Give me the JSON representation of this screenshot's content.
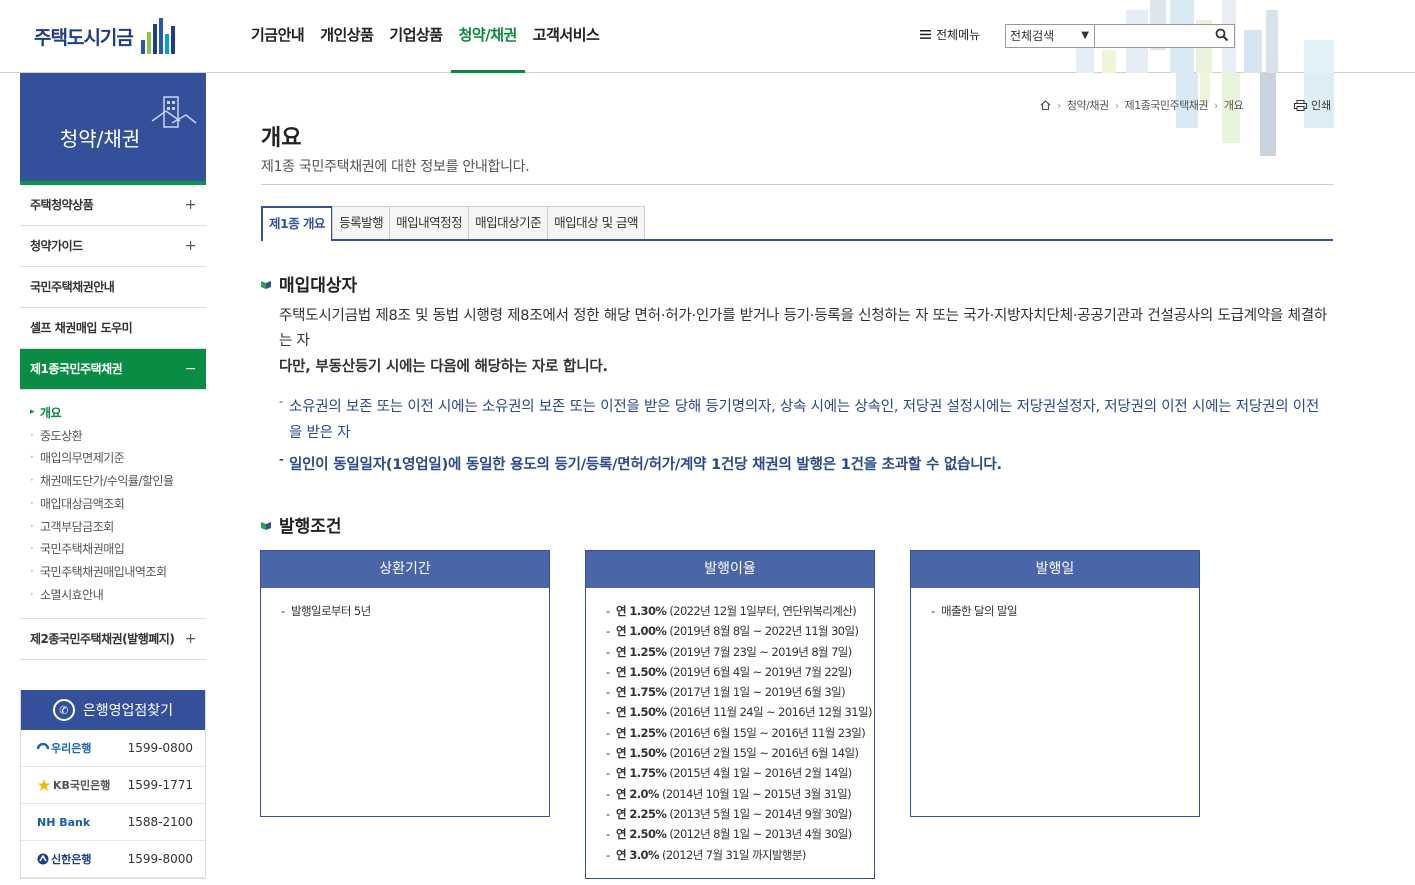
{
  "header": {
    "logo_text": "주택도시기금",
    "nav": [
      "기금안내",
      "개인상품",
      "기업상품",
      "청약/채권",
      "고객서비스"
    ],
    "nav_active": "청약/채권",
    "all_menu": "전체메뉴",
    "search_select": "전체검색",
    "search_placeholder": ""
  },
  "sidebar": {
    "title": "청약/채권",
    "items": [
      {
        "label": "주택청약상품",
        "toggle": "+"
      },
      {
        "label": "청약가이드",
        "toggle": "+"
      },
      {
        "label": "국민주택채권안내",
        "toggle": ""
      },
      {
        "label": "셀프 채권매입 도우미",
        "toggle": ""
      },
      {
        "label": "제1종국민주택채권",
        "toggle": "−"
      },
      {
        "label": "제2종국민주택채권(발행폐지)",
        "toggle": "+"
      }
    ],
    "sub_items": [
      "개요",
      "중도상환",
      "매입의무면제기준",
      "채권매도단가/수익률/할인율",
      "매입대상금액조회",
      "고객부담금조회",
      "국민주택채권매입",
      "국민주택채권매입내역조회",
      "소멸시효안내"
    ],
    "bank_finder": {
      "title": "은행영업점찾기",
      "banks": [
        {
          "name": "우리은행",
          "phone": "1599-0800"
        },
        {
          "name": "KB국민은행",
          "phone": "1599-1771"
        },
        {
          "name": "NH Bank",
          "phone": "1588-2100"
        },
        {
          "name": "신한은행",
          "phone": "1599-8000"
        }
      ]
    }
  },
  "breadcrumb": [
    "청약/채권",
    "제1종국민주택채권",
    "개요"
  ],
  "print_label": "인쇄",
  "page": {
    "title": "개요",
    "description": "제1종 국민주택채권에 대한 정보를 안내합니다."
  },
  "tabs": [
    "제1종 개요",
    "등록발행",
    "매입내역정정",
    "매입대상기준",
    "매입대상 및 금액"
  ],
  "section1": {
    "heading": "매입대상자",
    "para1": "주택도시기금법 제8조 및 동법 시행령 제8조에서 정한 해당 면허·허가·인가를 받거나 등기·등록을 신청하는 자 또는 국가·지방자치단체·공공기관과 건설공사의 도급계약을 체결하는 자",
    "para2": "다만, 부동산등기 시에는 다음에 해당하는 자로 합니다.",
    "bullet1": "소유권의 보존 또는 이전 시에는 소유권의 보존 또는 이전을 받은 당해 등기명의자, 상속 시에는 상속인, 저당권 설정시에는 저당권설정자, 저당권의 이전 시에는 저당권의 이전을 받은 자",
    "bullet2": "일인이 동일일자(1영업일)에 동일한 용도의 등기/등록/면허/허가/계약 1건당 채권의 발행은 1건을 초과할 수 없습니다."
  },
  "section2": {
    "heading": "발행조건",
    "cards": [
      {
        "title": "상환기간",
        "items": [
          {
            "b": "",
            "t": "발행일로부터 5년"
          }
        ]
      },
      {
        "title": "발행이율",
        "items": [
          {
            "b": "연 1.30%",
            "t": " (2022년 12월 1일부터, 연단위복리계산)"
          },
          {
            "b": "연 1.00%",
            "t": " (2019년 8월 8일 ~ 2022년 11월 30일)"
          },
          {
            "b": "연 1.25%",
            "t": " (2019년 7월 23일 ~ 2019년 8월 7일)"
          },
          {
            "b": "연 1.50%",
            "t": " (2019년 6월 4일 ~ 2019년 7월 22일)"
          },
          {
            "b": "연 1.75%",
            "t": " (2017년 1월 1일 ~ 2019년 6월 3일)"
          },
          {
            "b": "연 1.50%",
            "t": " (2016년 11월 24일 ~ 2016년 12월 31일)"
          },
          {
            "b": "연 1.25%",
            "t": " (2016년 6월 15일 ~ 2016년 11월 23일)"
          },
          {
            "b": "연 1.50%",
            "t": " (2016년 2월 15일 ~ 2016년 6월 14일)"
          },
          {
            "b": "연 1.75%",
            "t": " (2015년 4월 1일 ~ 2016년 2월 14일)"
          },
          {
            "b": "연 2.0%",
            "t": " (2014년 10월 1일 ~ 2015년 3월 31일)"
          },
          {
            "b": "연 2.25%",
            "t": " (2013년 5월 1일 ~ 2014년 9월 30일)"
          },
          {
            "b": "연 2.50%",
            "t": " (2012년 8월 1일 ~ 2013년 4월 30일)"
          },
          {
            "b": "연 3.0%",
            "t": " (2012년 7월 31일 까지발행분)"
          }
        ]
      },
      {
        "title": "발행일",
        "items": [
          {
            "b": "",
            "t": "매출한 달의 말일"
          }
        ]
      }
    ]
  },
  "colors": {
    "primary": "#34509a",
    "green": "#0b8c44"
  }
}
